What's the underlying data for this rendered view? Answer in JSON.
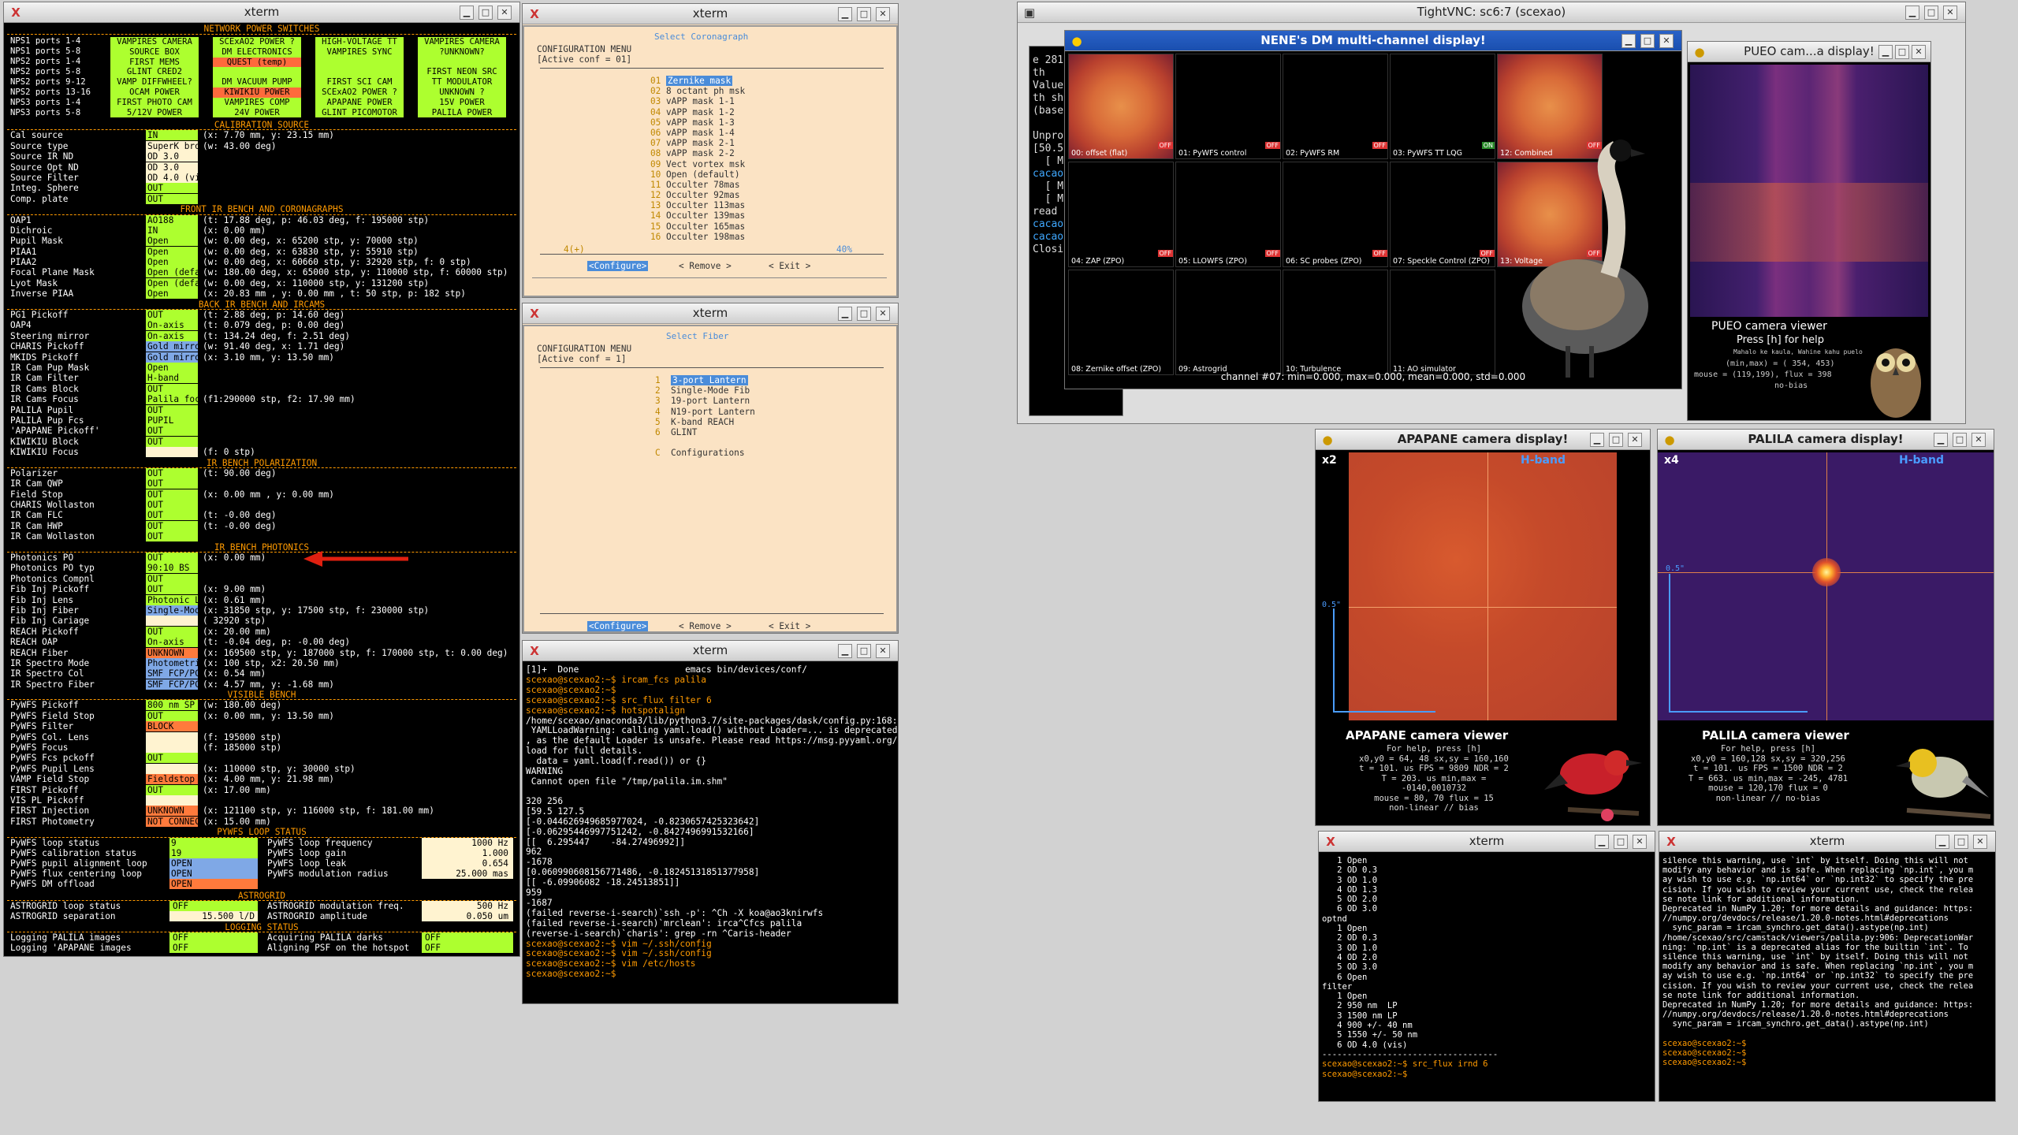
{
  "xterm1": {
    "title": "xterm"
  },
  "status": {
    "power_title": "NETWORK POWER SWITCHES",
    "power_labels": [
      "NPS1 ports 1-4",
      "NPS1 ports 5-8",
      "NPS2 ports 1-4",
      "NPS2 ports 5-8",
      "NPS2 ports 9-12",
      "NPS2 ports 13-16",
      "NPS3 ports 1-4",
      "NPS3 ports 5-8"
    ],
    "power_cols": [
      [
        "VAMPIRES CAMERA",
        "SOURCE BOX",
        "FIRST MEMS",
        "GLINT CRED2",
        "VAMP DIFFWHEEL?",
        "OCAM POWER",
        "FIRST PHOTO CAM",
        "5/12V POWER"
      ],
      [
        "SCExAO2 POWER ?",
        "DM ELECTRONICS",
        "QUEST (temp)",
        "",
        "DM VACUUM PUMP",
        "KIWIKIU POWER",
        "VAMPIRES COMP",
        "24V POWER"
      ],
      [
        "HIGH-VOLTAGE TT",
        "VAMPIRES SYNC",
        "",
        "",
        "FIRST SCI CAM",
        "SCExAO2 POWER ?",
        "APAPANE POWER",
        "GLINT PICOMOTOR"
      ],
      [
        "VAMPIRES CAMERA",
        "?UNKNOWN?",
        "",
        "FIRST NEON SRC",
        "TT MODULATOR",
        "UNKNOWN ?",
        "15V POWER",
        "PALILA POWER"
      ]
    ],
    "rows": [
      {
        "t": "sec",
        "text": "CALIBRATION SOURCE"
      },
      {
        "l": "Cal source",
        "v": "IN",
        "c": "g",
        "i": "(x:  7.70 mm, y: 23.15 mm)"
      },
      {
        "l": "Source type",
        "v": "SuperK broadband",
        "c": "w",
        "i": "(w: 43.00 deg)"
      },
      {
        "l": "Source IR ND",
        "v": "OD 3.0",
        "c": "w",
        "i": ""
      },
      {
        "l": "Source Opt ND",
        "v": "OD 3.0",
        "c": "w",
        "i": ""
      },
      {
        "l": "Source Filter",
        "v": "OD 4.0 (vis)",
        "c": "w",
        "i": ""
      },
      {
        "l": "Integ. Sphere",
        "v": "OUT",
        "c": "g",
        "i": ""
      },
      {
        "l": "Comp. plate",
        "v": "OUT",
        "c": "g",
        "i": ""
      },
      {
        "t": "sec",
        "text": "FRONT IR BENCH AND CORONAGRAPHS"
      },
      {
        "l": "OAP1",
        "v": "AO188",
        "c": "g",
        "i": "(t: 17.88 deg, p: 46.03 deg, f: 195000 stp)"
      },
      {
        "l": "Dichroic",
        "v": "IN",
        "c": "g",
        "i": "(x:  0.00 mm)"
      },
      {
        "l": "Pupil Mask",
        "v": "Open",
        "c": "g",
        "i": "(w: 0.00 deg, x: 65200 stp, y: 70000 stp)"
      },
      {
        "l": "PIAA1",
        "v": "Open",
        "c": "g",
        "i": "(w: 0.00 deg, x: 63830 stp, y: 55910 stp)"
      },
      {
        "l": "PIAA2",
        "v": "Open",
        "c": "g",
        "i": "(w: 0.00 deg, x: 60660 stp, y: 32920 stp, f:    0 stp)"
      },
      {
        "l": "Focal Plane Mask",
        "v": "Open (default)",
        "c": "g",
        "i": "(w: 180.00 deg, x: 65000 stp, y: 110000 stp, f: 60000 stp)"
      },
      {
        "l": "Lyot Mask",
        "v": "Open (default)",
        "c": "g",
        "i": "(w: 0.00 deg, x: 110000 stp, y: 131200 stp)"
      },
      {
        "l": "Inverse PIAA",
        "v": "Open",
        "c": "g",
        "i": "(x: 20.83 mm , y:  0.00 mm , t:   50 stp, p:   182 stp)"
      },
      {
        "t": "sec",
        "text": "BACK IR BENCH AND IRCAMS"
      },
      {
        "l": "PG1 Pickoff",
        "v": "OUT",
        "c": "g",
        "i": "(t:  2.88 deg, p: 14.60 deg)"
      },
      {
        "l": "OAP4",
        "v": "On-axis",
        "c": "g",
        "i": "(t:  0.079 deg, p:  0.00 deg)"
      },
      {
        "l": "Steering mirror",
        "v": "On-axis",
        "c": "g",
        "i": "(t: 134.24 deg, f:  2.51 deg)"
      },
      {
        "l": "CHARIS Pickoff",
        "v": "Gold mirror",
        "c": "b",
        "i": "(w: 91.40 deg, x:  1.71 deg)"
      },
      {
        "l": "MKIDS Pickoff",
        "v": "Gold mirror",
        "c": "b",
        "i": "(x:  3.10 mm, y: 13.50 mm)"
      },
      {
        "l": "IR Cam Pup Mask",
        "v": "Open",
        "c": "g",
        "i": ""
      },
      {
        "l": "IR Cam Filter",
        "v": "H-band",
        "c": "g",
        "i": ""
      },
      {
        "l": "IR Cams Block",
        "v": "OUT",
        "c": "g",
        "i": ""
      },
      {
        "l": "IR Cams Focus",
        "v": "Palila focus",
        "c": "g",
        "i": "(f1:290000 stp, f2: 17.90 mm)"
      },
      {
        "l": "PALILA Pupil",
        "v": "OUT",
        "c": "g",
        "i": ""
      },
      {
        "l": "PALILA Pup Fcs",
        "v": "PUPIL",
        "c": "g",
        "i": ""
      },
      {
        "l": "'APAPANE Pickoff'",
        "v": "OUT",
        "c": "g",
        "i": ""
      },
      {
        "l": "KIWIKIU Block",
        "v": "OUT",
        "c": "g",
        "i": ""
      },
      {
        "l": "KIWIKIU Focus",
        "v": "",
        "c": "w",
        "i": "(f:        0 stp)"
      },
      {
        "t": "sec",
        "text": "IR BENCH POLARIZATION"
      },
      {
        "l": "Polarizer",
        "v": "OUT",
        "c": "g",
        "i": "(t: 90.00 deg)"
      },
      {
        "l": "IR Cam QWP",
        "v": "OUT",
        "c": "g",
        "i": ""
      },
      {
        "l": "Field Stop",
        "v": "OUT",
        "c": "g",
        "i": "(x:  0.00 mm , y:  0.00 mm)"
      },
      {
        "l": "CHARIS Wollaston",
        "v": "OUT",
        "c": "g",
        "i": ""
      },
      {
        "l": "IR Cam FLC",
        "v": "OUT",
        "c": "g",
        "i": "(t: -0.00 deg)"
      },
      {
        "l": "IR Cam HWP",
        "v": "OUT",
        "c": "g",
        "i": "(t: -0.00 deg)"
      },
      {
        "l": "IR Cam Wollaston",
        "v": "OUT",
        "c": "g",
        "i": ""
      },
      {
        "t": "sec",
        "text": "IR BENCH PHOTONICS"
      },
      {
        "l": "Photonics PO",
        "v": "OUT",
        "c": "g",
        "i": "(x:  0.00 mm)"
      },
      {
        "l": "Photonics PO typ",
        "v": "90:10 BS",
        "c": "g",
        "i": ""
      },
      {
        "l": "Photonics Compnl",
        "v": "OUT",
        "c": "g",
        "i": ""
      },
      {
        "l": "Fib Inj Pickoff",
        "v": "OUT",
        "c": "g",
        "i": "(x:  9.00 mm)"
      },
      {
        "l": "Fib Inj Lens",
        "v": "Photonic Lant.",
        "c": "g",
        "i": "(x:  0.61 mm)"
      },
      {
        "l": "Fib Inj Fiber",
        "v": "Single-Mode Fib",
        "c": "b",
        "i": "(x: 31850 stp, y: 17500 stp, f: 230000 stp)"
      },
      {
        "l": "Fib Inj Cariage",
        "v": "",
        "c": "w",
        "i": "(     32920 stp)"
      },
      {
        "l": "REACH Pickoff",
        "v": "OUT",
        "c": "g",
        "i": "(x: 20.00 mm)"
      },
      {
        "l": "REACH OAP",
        "v": "On-axis",
        "c": "g",
        "i": "(t: -0.04 deg, p: -0.00 deg)"
      },
      {
        "l": "REACH Fiber",
        "v": "UNKNOWN",
        "c": "o",
        "i": "(x: 169500 stp, y: 187000 stp, f: 170000 stp, t:  0.00 deg)"
      },
      {
        "l": "IR Spectro Mode",
        "v": "Photometric",
        "c": "b",
        "i": "(x:    100 stp, x2: 20.50 mm)"
      },
      {
        "l": "IR Spectro Col",
        "v": "SMF FCP/PC",
        "c": "b",
        "i": "(x:  0.54 mm)"
      },
      {
        "l": "IR Spectro Fiber",
        "v": "SMF FCP/PC",
        "c": "b",
        "i": "(x:  4.57 mm, y: -1.68 mm)"
      },
      {
        "t": "sec",
        "text": "VISIBLE BENCH"
      },
      {
        "l": "PyWFS Pickoff",
        "v": "800 nm SP (dflt",
        "c": "g",
        "i": "(w: 180.00 deg)"
      },
      {
        "l": "PyWFS Field Stop",
        "v": "OUT",
        "c": "g",
        "i": "(x:  0.00 mm, y: 13.50 mm)"
      },
      {
        "l": "PyWFS Filter",
        "v": "BLOCK",
        "c": "o",
        "i": ""
      },
      {
        "l": "PyWFS Col. Lens",
        "v": "",
        "c": "w",
        "i": "(f: 195000 stp)"
      },
      {
        "l": "PyWFS Focus",
        "v": "",
        "c": "w",
        "i": "(f: 185000 stp)"
      },
      {
        "l": "PyWFS Fcs pckoff",
        "v": "OUT",
        "c": "g",
        "i": ""
      },
      {
        "l": "PyWFS Pupil Lens",
        "v": "",
        "c": "w",
        "i": "(x: 110000 stp, y: 30000 stp)"
      },
      {
        "l": "VAMP Field Stop",
        "v": "Fieldstop",
        "c": "o",
        "i": "(x:  4.00 mm, y: 21.98 mm)"
      },
      {
        "l": "FIRST Pickoff",
        "v": "OUT",
        "c": "g",
        "i": "(x: 17.00 mm)"
      },
      {
        "l": "VIS PL Pickoff",
        "v": "",
        "c": "w",
        "i": ""
      },
      {
        "l": "FIRST Injection",
        "v": "UNKNOWN",
        "c": "o",
        "i": "(x: 121100 stp, y: 116000 stp, f: 181.00 mm)"
      },
      {
        "l": "FIRST Photometry",
        "v": "NOT CONNECTED",
        "c": "o",
        "i": "(x: 15.00 mm)"
      }
    ],
    "pywfs_title": "PYWFS LOOP STATUS",
    "pywfs_left": [
      [
        "PyWFS loop status",
        "9",
        "g"
      ],
      [
        "PyWFS calibration status",
        "19",
        "g"
      ],
      [
        "PyWFS pupil alignment loop",
        "OPEN",
        "b"
      ],
      [
        "PyWFS flux centering loop",
        "OPEN",
        "b"
      ],
      [
        "PyWFS DM offload",
        "OPEN",
        "o"
      ]
    ],
    "pywfs_right": [
      [
        "PyWFS loop frequency",
        "1000 Hz"
      ],
      [
        "PyWFS loop gain",
        "1.000"
      ],
      [
        "PyWFS loop leak",
        "0.654"
      ],
      [
        "PyWFS modulation radius",
        "25.000 mas"
      ]
    ],
    "astro_title": "ASTROGRID",
    "astro": [
      [
        "ASTROGRID loop status",
        "OFF",
        "ASTROGRID modulation freq.",
        "500 Hz"
      ],
      [
        "ASTROGRID separation",
        "15.500 l/D",
        "ASTROGRID amplitude",
        "0.050 um"
      ]
    ],
    "log_title": "LOGGING STATUS",
    "log": [
      [
        "Logging PALILA images",
        "OFF",
        "Acquiring PALILA darks",
        "OFF"
      ],
      [
        "Logging 'APAPANE images",
        "OFF",
        "Aligning PSF on the hotspot",
        "OFF"
      ]
    ]
  },
  "cfg1": {
    "title": "xterm",
    "head": "Select Coronagraph",
    "line1": "CONFIGURATION MENU",
    "line2": "[Active conf = 01]",
    "items": [
      "Zernike mask",
      "8 octant ph msk",
      "vAPP mask 1-1",
      "vAPP mask 1-2",
      "vAPP mask 1-3",
      "vAPP mask 1-4",
      "vAPP mask 2-1",
      "vAPP mask 2-2",
      "Vect vortex msk",
      "Open (default)",
      "Occulter 78mas",
      "Occulter 92mas",
      "Occulter 113mas",
      "Occulter 139mas",
      "Occulter 165mas",
      "Occulter 198mas"
    ],
    "nums": [
      "01",
      "02",
      "03",
      "04",
      "05",
      "06",
      "07",
      "08",
      "09",
      "10",
      "11",
      "12",
      "13",
      "14",
      "15",
      "16"
    ],
    "foot_left": "4(+)",
    "foot_right": "40%",
    "b1": "<Configure>",
    "b2": "< Remove  >",
    "b3": "<  Exit  >"
  },
  "cfg2": {
    "title": "xterm",
    "head": "Select Fiber",
    "line1": "CONFIGURATION MENU",
    "line2": "[Active conf = 1]",
    "items": [
      "3-port Lantern",
      "Single-Mode Fib",
      "19-port Lantern",
      "N19-port Lantern",
      "K-band REACH",
      "GLINT",
      "",
      "Configurations"
    ],
    "nums": [
      "1",
      "2",
      "3",
      "4",
      "5",
      "6",
      "",
      "C"
    ],
    "b1": "<Configure>",
    "b2": "< Remove  >",
    "b3": "<  Exit  >"
  },
  "term1": {
    "title": "xterm",
    "lines": [
      "[1]+  Done                    emacs bin/devices/conf/",
      "scexao@scexao2:~$ ircam_fcs palila",
      "scexao@scexao2:~$",
      "scexao@scexao2:~$ src_flux filter 6",
      "scexao@scexao2:~$ hotspotalign",
      "/home/scexao/anaconda3/lib/python3.7/site-packages/dask/config.py:168:",
      " YAMLLoadWarning: calling yaml.load() without Loader=... is deprecated",
      ", as the default Loader is unsafe. Please read https://msg.pyyaml.org/",
      "load for full details.",
      "  data = yaml.load(f.read()) or {}",
      "WARNING",
      " Cannot open file \"/tmp/palila.im.shm\"",
      "",
      "320 256",
      "[59.5 127.5",
      "[-0.044626949685977024, -0.8230657425323642]",
      "[-0.06295446997751242, -0.8427496991532166]",
      "[[  6.295447    -84.27496992]]",
      "962",
      "-1678",
      "[0.060990608156771486, -0.18245131851377958]",
      "[[ -6.09906082 -18.24513851]]",
      "959",
      "-1687",
      "(failed reverse-i-search)`ssh -p': ^Ch -X koa@ao3knirwfs",
      "(failed reverse-i-search)`mrclean': irca^Cfcs palila",
      "(reverse-i-search)`charis': grep -rn ^Caris-header",
      "scexao@scexao2:~$ vim ~/.ssh/config",
      "scexao@scexao2:~$ vim ~/.ssh/config",
      "scexao@scexao2:~$ vim /etc/hosts",
      "scexao@scexao2:~$ "
    ]
  },
  "vnc": {
    "title": "TightVNC: sc6:7 (scexao)",
    "side_lines": [
      "e 281",
      "th",
      "Value",
      "th sh",
      "(base",
      "",
      "Unpro",
      "[50.5",
      "  [ MI",
      "cacao",
      "  [ MI",
      "  [ MI",
      "read",
      "cacao",
      "cacao",
      "Closi"
    ]
  },
  "nene": {
    "title": "NENE's DM multi-channel display!",
    "cells": [
      "00: offset (flat)",
      "01: PyWFS control",
      "02: PyWFS RM",
      "03: PyWFS TT LQG",
      "12: Combined",
      "04: ZAP (ZPO)",
      "05: LLOWFS (ZPO)",
      "06: SC probes (ZPO)",
      "07: Speckle Control (ZPO)",
      "13: Voltage",
      "08: Zernike offset (ZPO)",
      "09: Astrogrid",
      "10: Turbulence",
      "11: AO simulator"
    ],
    "flags": [
      "OFF",
      "OFF",
      "OFF",
      "ON",
      "OFF",
      "OFF",
      "OFF",
      "OFF",
      "OFF",
      "OFF"
    ],
    "status": "channel #07:   min=0.000,   max=0.000,   mean=0.000,   std=0.000"
  },
  "pueo": {
    "title": "PUEO cam...a display!",
    "viewer": "PUEO camera viewer",
    "help": "Press [h] for help",
    "sub1": "Mahalo ke kaula, Wahine kahu puelo",
    "sub2": "(min,max) = ( 354, 453)",
    "sub3": "mouse = (119,199), flux =  398",
    "sub4": "no-bias"
  },
  "apapane": {
    "title": "APAPANE camera display!",
    "zoom": "x2",
    "band": "H-band",
    "axis": "0.5\"",
    "viewer": "APAPANE camera viewer",
    "info": [
      "For help, press [h]",
      "x0,y0 = 64, 48 sx,sy = 160,160",
      "t = 101. us FPS = 9809 NDR =  2",
      "T = 203. us min,max = -0140,0010732",
      "mouse = 80, 70 flux =  15",
      "non-linear //   bias"
    ]
  },
  "palila": {
    "title": "PALILA camera display!",
    "zoom": "x4",
    "band": "H-band",
    "axis": "0.5\"",
    "viewer": "PALILA camera viewer",
    "info": [
      "For help, press [h]",
      "x0,y0 = 160,128 sx,sy = 320,256",
      "t = 101. us FPS = 1500 NDR =  2",
      "T = 663. us min,max = -245, 4781",
      "mouse = 120,170 flux =   0",
      "non-linear // no-bias"
    ]
  },
  "term2": {
    "title": "xterm",
    "lines": [
      "   1 Open",
      "   2 OD 0.3",
      "   3 OD 1.0",
      "   4 OD 1.3",
      "   5 OD 2.0",
      "   6 OD 3.0",
      "optnd",
      "   1 Open",
      "   2 OD 0.3",
      "   3 OD 1.0",
      "   4 OD 2.0",
      "   5 OD 3.0",
      "   6 Open",
      "filter",
      "   1 Open",
      "   2 950 nm  LP",
      "   3 1500 nm LP",
      "   4 900 +/- 40 nm",
      "   5 1550 +/- 50 nm",
      "   6 OD 4.0 (vis)",
      "-----------------------------------",
      "scexao@scexao2:~$ src_flux irnd 6",
      "scexao@scexao2:~$ "
    ]
  },
  "term3": {
    "title": "xterm",
    "lines": [
      "silence this warning, use `int` by itself. Doing this will not",
      "modify any behavior and is safe. When replacing `np.int`, you m",
      "ay wish to use e.g. `np.int64` or `np.int32` to specify the pre",
      "cision. If you wish to review your current use, check the relea",
      "se note link for additional information.",
      "Deprecated in NumPy 1.20; for more details and guidance: https:",
      "//numpy.org/devdocs/release/1.20.0-notes.html#deprecations",
      "  sync_param = ircam_synchro.get_data().astype(np.int)",
      "/home/scexao/src/camstack/viewers/palila.py:906: DeprecationWar",
      "ning: `np.int` is a deprecated alias for the builtin `int`. To",
      "silence this warning, use `int` by itself. Doing this will not",
      "modify any behavior and is safe. When replacing `np.int`, you m",
      "ay wish to use e.g. `np.int64` or `np.int32` to specify the pre",
      "cision. If you wish to review your current use, check the relea",
      "se note link for additional information.",
      "Deprecated in NumPy 1.20; for more details and guidance: https:",
      "//numpy.org/devdocs/release/1.20.0-notes.html#deprecations",
      "  sync_param = ircam_synchro.get_data().astype(np.int)",
      "",
      "scexao@scexao2:~$",
      "scexao@scexao2:~$",
      "scexao@scexao2:~$ "
    ]
  },
  "colors": {
    "green": "#adff2f",
    "orange": "#ff7a3c",
    "blue": "#7fa8e6",
    "prompt": "#ff9a00",
    "accent": "#ff9a00"
  }
}
